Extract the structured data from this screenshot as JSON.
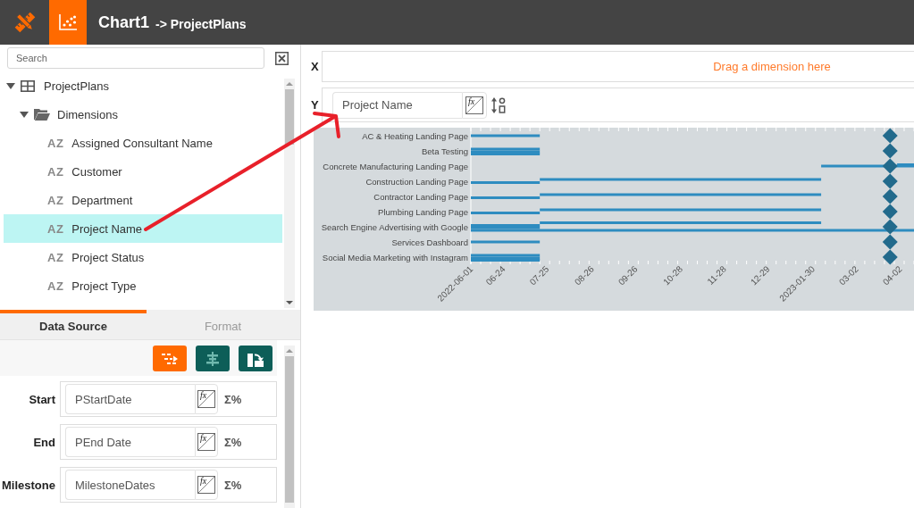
{
  "header": {
    "title": "Chart1",
    "subtitle": "-> ProjectPlans"
  },
  "search": {
    "placeholder": "Search"
  },
  "tree": [
    {
      "kind": "table",
      "label": "ProjectPlans",
      "expanded": true,
      "selected": false,
      "children": [
        {
          "kind": "folder",
          "label": "Dimensions",
          "expanded": true,
          "selected": false,
          "children": [
            {
              "kind": "field",
              "type_icon": "AZ",
              "label": "Assigned Consultant Name",
              "selected": false
            },
            {
              "kind": "field",
              "type_icon": "AZ",
              "label": "Customer",
              "selected": false
            },
            {
              "kind": "field",
              "type_icon": "AZ",
              "label": "Department",
              "selected": false
            },
            {
              "kind": "field",
              "type_icon": "AZ",
              "label": "Project Name",
              "selected": true
            },
            {
              "kind": "field",
              "type_icon": "AZ",
              "label": "Project Status",
              "selected": false
            },
            {
              "kind": "field",
              "type_icon": "AZ",
              "label": "Project Type",
              "selected": false
            }
          ]
        }
      ]
    }
  ],
  "panel_tabs": [
    {
      "label": "Data Source",
      "selected": true
    },
    {
      "label": "Format",
      "selected": false
    }
  ],
  "toolbar_buttons": [
    {
      "kind": "steps",
      "selected": true
    },
    {
      "kind": "align",
      "selected": false
    },
    {
      "kind": "rotate",
      "selected": false
    }
  ],
  "data_fields": [
    {
      "label": "Start",
      "value": "PStartDate",
      "formula_icon": "fx",
      "aggregate_icon": "Σ%"
    },
    {
      "label": "End",
      "value": "PEnd Date",
      "formula_icon": "fx",
      "aggregate_icon": "Σ%"
    },
    {
      "label": "Milestone",
      "value": "MilestoneDates",
      "formula_icon": "fx",
      "aggregate_icon": "Σ%"
    }
  ],
  "x_axis": {
    "label": "X",
    "placeholder": "Drag a dimension here"
  },
  "y_axis": {
    "label": "Y",
    "value": "Project Name",
    "formula_icon": "fx"
  },
  "gantt_chart": {
    "row_labels": [
      "AC & Heating Landing Page",
      "Beta Testing",
      "Concrete Manufacturing Landing Page",
      "Construction Landing Page",
      "Contractor Landing Page",
      "Plumbing Landing Page",
      "Search Engine Advertising with Google",
      "Services Dashboard",
      "Social Media Marketing with Instagram"
    ],
    "date_labels": [
      "2022-06-01",
      "06-24",
      "07-25",
      "08-26",
      "09-26",
      "10-28",
      "11-28",
      "12-29",
      "2023-01-30",
      "03-02",
      "04-02"
    ]
  },
  "overlay": {
    "kind": "arrow"
  }
}
